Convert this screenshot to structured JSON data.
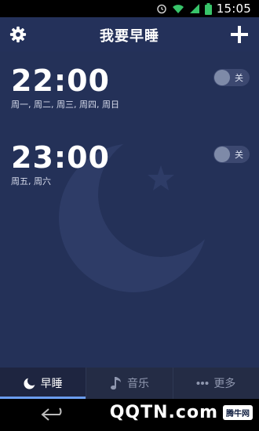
{
  "status_bar": {
    "time": "15:05",
    "icons": [
      "alarm-icon",
      "wifi-icon",
      "signal-icon",
      "battery-icon"
    ]
  },
  "header": {
    "title": "我要早睡",
    "settings_icon": "gear-icon",
    "add_icon": "plus-icon"
  },
  "alarms": [
    {
      "time": "22:00",
      "days": "周一, 周二, 周三, 周四, 周日",
      "toggle_label": "关",
      "enabled": false
    },
    {
      "time": "23:00",
      "days": "周五, 周六",
      "toggle_label": "关",
      "enabled": false
    }
  ],
  "tabs": [
    {
      "label": "早睡",
      "icon": "moon-icon",
      "active": true
    },
    {
      "label": "音乐",
      "icon": "music-note-icon",
      "active": false
    },
    {
      "label": "更多",
      "icon": "more-dots-icon",
      "active": false
    }
  ],
  "nav": {
    "back_icon": "back-arrow-icon"
  },
  "watermark": {
    "text": "QQTN.com",
    "badge": "腾牛网"
  },
  "colors": {
    "background": "#243158",
    "header": "#24315a",
    "tab_bar": "#242c45",
    "active_tab_indicator": "#6b9df0",
    "status_bar": "#000000"
  }
}
